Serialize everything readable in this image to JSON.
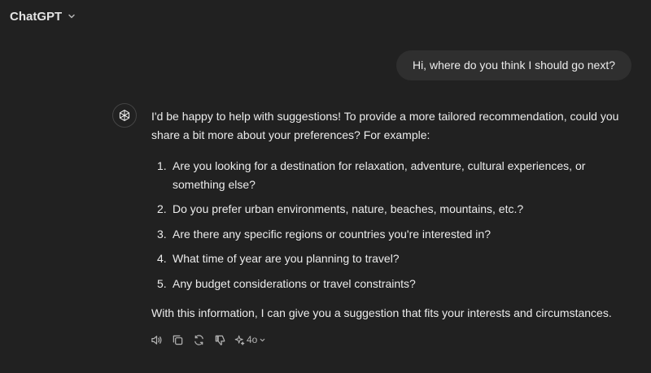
{
  "header": {
    "title": "ChatGPT"
  },
  "user_message": "Hi, where do you think I should go next?",
  "assistant": {
    "intro": "I'd be happy to help with suggestions! To provide a more tailored recommendation, could you share a bit more about your preferences? For example:",
    "items": [
      {
        "num": "1.",
        "text": "Are you looking for a destination for relaxation, adventure, cultural experiences, or something else?"
      },
      {
        "num": "2.",
        "text": "Do you prefer urban environments, nature, beaches, mountains, etc.?"
      },
      {
        "num": "3.",
        "text": "Are there any specific regions or countries you're interested in?"
      },
      {
        "num": "4.",
        "text": "What time of year are you planning to travel?"
      },
      {
        "num": "5.",
        "text": "Any budget considerations or travel constraints?"
      }
    ],
    "outro": "With this information, I can give you a suggestion that fits your interests and circumstances."
  },
  "actions": {
    "model": "4o"
  },
  "icons": {
    "header_chevron": "chevron-down-icon",
    "avatar": "openai-logo-icon",
    "read_aloud": "speaker-icon",
    "copy": "copy-icon",
    "regenerate": "refresh-icon",
    "dislike": "thumbs-down-icon",
    "model": "sparkle-icon"
  },
  "colors": {
    "background": "#212121",
    "bubble": "#2f2f2f",
    "text": "#ececec",
    "muted": "#b4b4b4"
  }
}
